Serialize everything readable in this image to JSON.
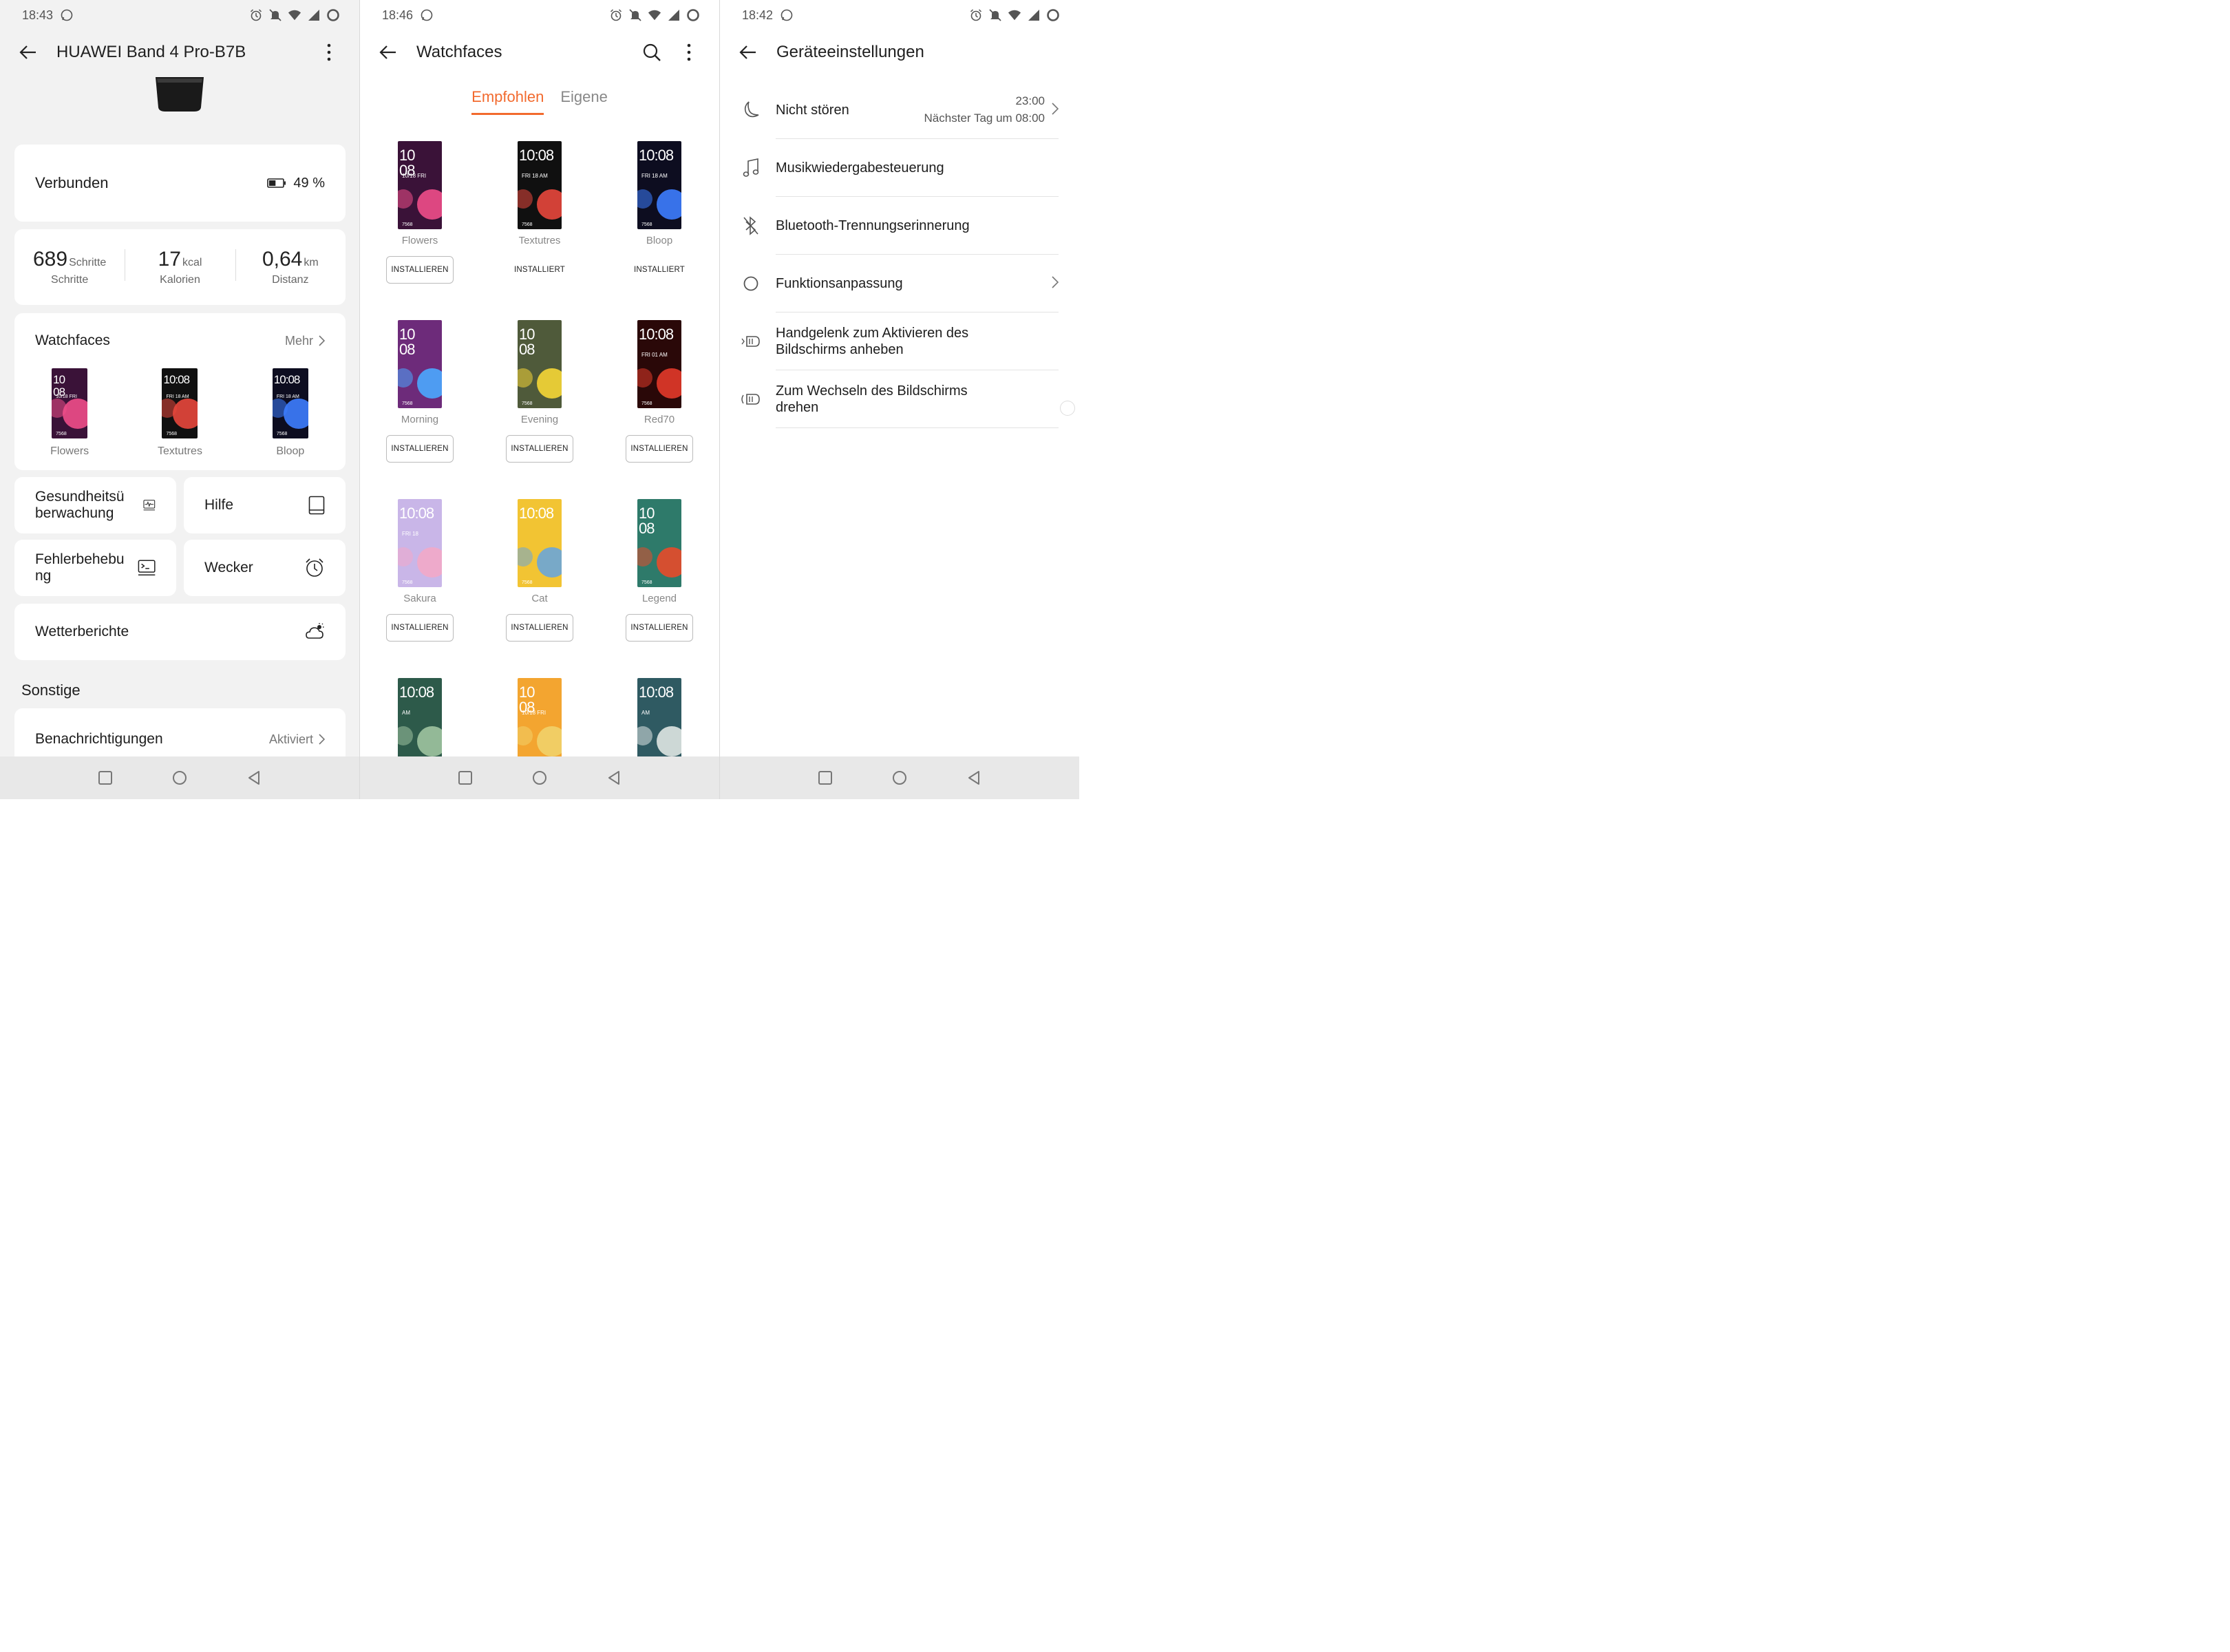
{
  "panels": {
    "device": {
      "status_time": "18:43",
      "title": "HUAWEI Band 4 Pro-B7B",
      "connected_label": "Verbunden",
      "battery": "49 %",
      "battery_level": 0.49,
      "stats": [
        {
          "value": "689",
          "unit": "Schritte",
          "label": "Schritte"
        },
        {
          "value": "17",
          "unit": "kcal",
          "label": "Kalorien"
        },
        {
          "value": "0,64",
          "unit": "km",
          "label": "Distanz"
        }
      ],
      "watchfaces_title": "Watchfaces",
      "watchfaces_more": "Mehr",
      "watchfaces": [
        "Flowers",
        "Textutres",
        "Bloop"
      ],
      "tiles": [
        {
          "label": "Gesundheitsü berwachung",
          "icon": "heart-monitor-icon"
        },
        {
          "label": "Hilfe",
          "icon": "book-icon"
        },
        {
          "label": "Fehlerbehebu ng",
          "icon": "terminal-icon"
        },
        {
          "label": "Wecker",
          "icon": "alarm-clock-icon"
        }
      ],
      "weather_label": "Wetterberichte",
      "section_other": "Sonstige",
      "notifications_label": "Benachrichtigungen",
      "notifications_value": "Aktiviert"
    },
    "watchfaces": {
      "status_time": "18:46",
      "title": "Watchfaces",
      "tabs": [
        "Empfohlen",
        "Eigene"
      ],
      "active_tab": 0,
      "faces": [
        {
          "name": "Flowers",
          "action": "INSTALLIEREN",
          "installed": false,
          "time": "10 08",
          "date": "10/18 FRI",
          "steps": "7568",
          "bg": "#3a1238",
          "accent": "#f04e8a"
        },
        {
          "name": "Textutres",
          "action": "INSTALLIERT",
          "installed": true,
          "time": "10:08",
          "date": "FRI 18 AM",
          "steps": "7568",
          "bg": "#101010",
          "accent": "#e8473c"
        },
        {
          "name": "Bloop",
          "action": "INSTALLIERT",
          "installed": true,
          "time": "10:08",
          "date": "FRI 18 AM",
          "steps": "7568",
          "bg": "#0d0d20",
          "accent": "#3d7dff"
        },
        {
          "name": "Morning",
          "action": "INSTALLIEREN",
          "installed": false,
          "time": "10 08",
          "date": "",
          "steps": "7568",
          "bg": "#6d2b7a",
          "accent": "#4aa8ff"
        },
        {
          "name": "Evening",
          "action": "INSTALLIEREN",
          "installed": false,
          "time": "10 08",
          "date": "",
          "steps": "7568",
          "bg": "#4f5a3a",
          "accent": "#f5d636"
        },
        {
          "name": "Red70",
          "action": "INSTALLIEREN",
          "installed": false,
          "time": "10:08",
          "date": "FRI 01 AM",
          "steps": "7568",
          "bg": "#2a0808",
          "accent": "#e23a2a"
        },
        {
          "name": "Sakura",
          "action": "INSTALLIEREN",
          "installed": false,
          "time": "10:08",
          "date": "FRI 18",
          "steps": "7568",
          "bg": "#c9b6e8",
          "accent": "#f2a8c8"
        },
        {
          "name": "Cat",
          "action": "INSTALLIEREN",
          "installed": false,
          "time": "10:08",
          "date": "",
          "steps": "7568",
          "bg": "#f2c433",
          "accent": "#6aa6d8"
        },
        {
          "name": "Legend",
          "action": "INSTALLIEREN",
          "installed": false,
          "time": "10 08",
          "date": "",
          "steps": "7568",
          "bg": "#2e7a6a",
          "accent": "#e84a2a"
        },
        {
          "name": "",
          "action": "",
          "installed": false,
          "time": "10:08",
          "date": "AM",
          "steps": "",
          "bg": "#2d5a4a",
          "accent": "#9fc3a0"
        },
        {
          "name": "",
          "action": "",
          "installed": false,
          "time": "10 08",
          "date": "10/18 FRI",
          "steps": "",
          "bg": "#f3a530",
          "accent": "#f1d26a"
        },
        {
          "name": "",
          "action": "",
          "installed": false,
          "time": "10:08",
          "date": "AM",
          "steps": "",
          "bg": "#2f5a62",
          "accent": "#dfe6e3"
        }
      ]
    },
    "settings": {
      "status_time": "18:42",
      "title": "Geräteeinstellungen",
      "rows": [
        {
          "label": "Nicht stören",
          "icon": "moon-icon",
          "type": "times",
          "time": "23:00",
          "sub": "Nächster Tag um 08:00"
        },
        {
          "label": "Musikwiedergabesteuerung",
          "icon": "music-note-icon",
          "type": "toggle",
          "on": true
        },
        {
          "label": "Bluetooth-Trennungserinnerung",
          "icon": "bluetooth-off-icon",
          "type": "toggle",
          "on": true
        },
        {
          "label": "Funktionsanpassung",
          "icon": "circle-icon",
          "type": "chevron"
        },
        {
          "label": "Handgelenk zum Aktivieren des Bildschirms anheben",
          "icon": "wrist-raise-icon",
          "type": "toggle",
          "on": true
        },
        {
          "label": "Zum Wechseln des Bildschirms drehen",
          "icon": "wrist-rotate-icon",
          "type": "toggle",
          "on": false
        }
      ]
    }
  },
  "colors": {
    "accent": "#f26a2e",
    "bg_grey": "#f2f2f2"
  }
}
